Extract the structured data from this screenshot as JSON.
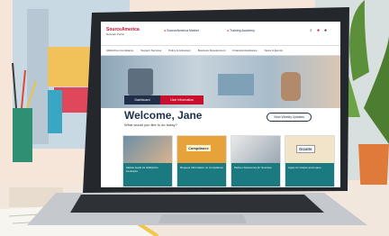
{
  "site": {
    "brand_line1": "SourceAmerica",
    "brand_line2": "Network Portal",
    "top_links": [
      "SourceAmerica Market",
      "Training Academy"
    ],
    "nav": [
      "AbilityOne Compliance",
      "Support Services",
      "Policy & Advocacy",
      "Business Development",
      "Financial Assistance",
      "News & Events"
    ],
    "tabs": [
      "Dashboard",
      "User Information"
    ],
    "welcome": "Welcome, Jane",
    "prompt": "What would you like to do today?",
    "updates_button": "View Weekly Updates",
    "cards": [
      {
        "label": "Market leads for AbilityOne Contracts",
        "image_text": ""
      },
      {
        "label": "Request Information on Compliance",
        "image_text": "Compliance"
      },
      {
        "label": "Partner Resources for Success",
        "image_text": ""
      },
      {
        "label": "Apply for Grants and Loans",
        "image_text": "Grants"
      }
    ]
  },
  "colors": {
    "brand_red": "#c8102e",
    "teal": "#1a7a80",
    "navy": "#1f2f4a"
  }
}
